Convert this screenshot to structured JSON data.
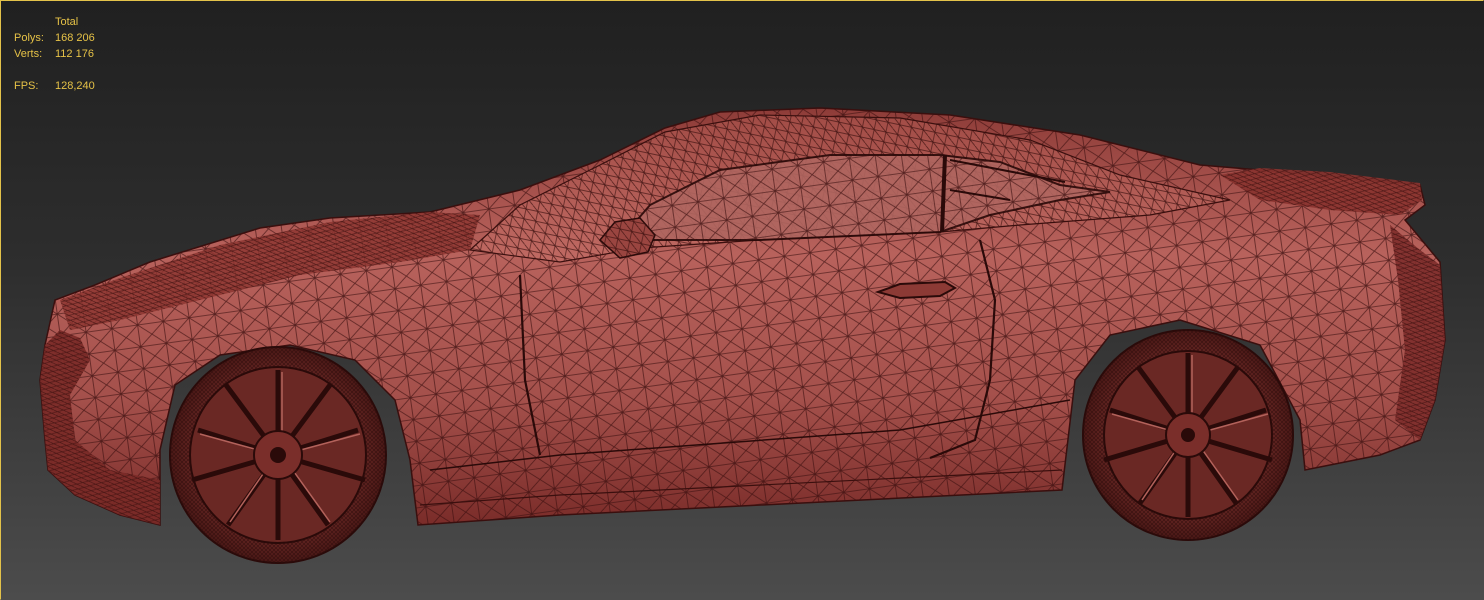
{
  "stats": {
    "header": "Total",
    "polys_label": "Polys:",
    "polys_value": "168 206",
    "verts_label": "Verts:",
    "verts_value": "112 176",
    "fps_label": "FPS:",
    "fps_value": "128,240"
  },
  "viewport": {
    "display_mode": "wireframe-on-shaded",
    "colors": {
      "text": "#e6c247",
      "border": "#e3c24a",
      "body": "#b25a55",
      "wire": "#3a0f0e",
      "background_top": "#202020",
      "background_bottom": "#4c4c4c"
    },
    "model_icon": "car-model-icon"
  }
}
